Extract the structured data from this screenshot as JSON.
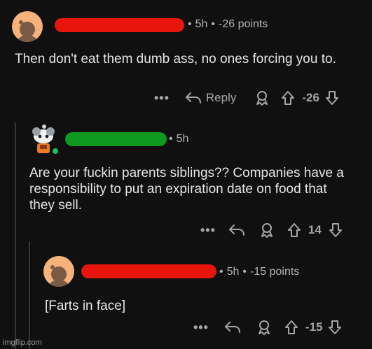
{
  "colors": {
    "background": "#101010",
    "redact_red": "#e8150c",
    "redact_green": "#0e9a1e",
    "avatar_bg": "#f6b27a"
  },
  "comments": [
    {
      "time": "5h",
      "score_text": "-26 points",
      "body": "Then don't eat them dumb ass, no ones forcing you to.",
      "actions": {
        "more": "•••",
        "reply": "Reply",
        "vote": "-26"
      }
    },
    {
      "time": "5h",
      "body": "Are your fuckin parents siblings?? Companies have a responsibility to put an expiration date on food that they sell.",
      "actions": {
        "more": "•••",
        "vote": "14"
      }
    },
    {
      "time": "5h",
      "score_text": "-15 points",
      "body": "[Farts in face]",
      "actions": {
        "more": "•••",
        "vote": "-15"
      }
    }
  ],
  "separator": "•",
  "watermark": "imgflip.com"
}
